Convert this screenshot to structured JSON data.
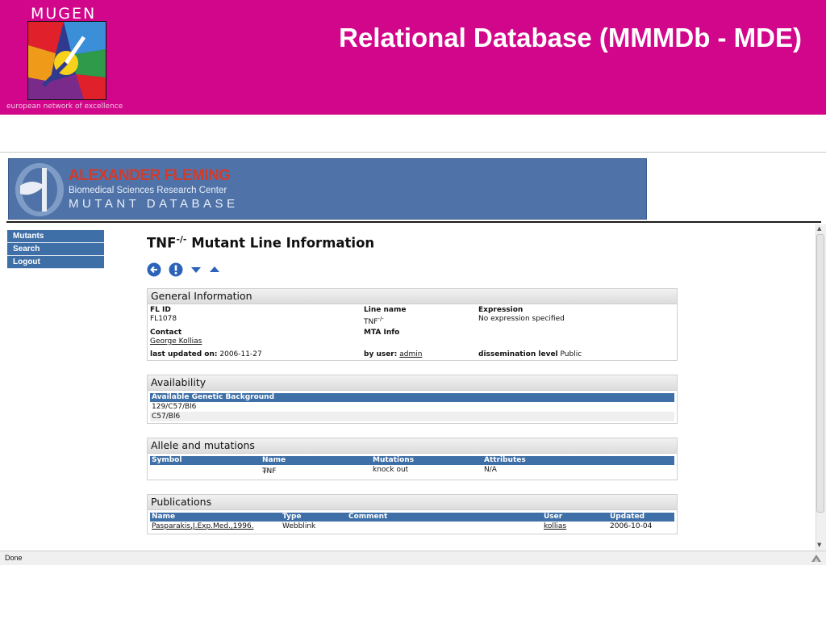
{
  "slide": {
    "logo_word": "MUGEN",
    "logo_tagline": "european network of excellence",
    "title": "Relational Database (MMMDb - MDE)"
  },
  "banner": {
    "name": "ALEXANDER FLEMING",
    "center": "Biomedical Sciences Research Center",
    "database": "MUTANT DATABASE"
  },
  "nav": {
    "items": [
      "Mutants",
      "Search",
      "Logout"
    ]
  },
  "page": {
    "heading_prefix": "TNF",
    "heading_sup": "-/-",
    "heading_suffix": " Mutant Line Information"
  },
  "toolbar": {
    "icons": [
      "back-icon",
      "info-icon",
      "expand-down-icon",
      "collapse-up-icon"
    ]
  },
  "general": {
    "title": "General Information",
    "fl_id_label": "FL ID",
    "fl_id": "FL1078",
    "line_name_label": "Line name",
    "line_name": "TNF",
    "line_name_sup": "-/-",
    "expression_label": "Expression",
    "expression": "No expression specified",
    "contact_label": "Contact",
    "contact": "George Kollias",
    "mta_label": "MTA Info",
    "updated_label": "last updated on:",
    "updated": "2006-11-27",
    "by_user_label": "by user:",
    "by_user": "admin",
    "dissemination_label": "dissemination level",
    "dissemination": "Public"
  },
  "availability": {
    "title": "Availability",
    "header": "Available Genetic Background",
    "rows": [
      "129/C57/Bl6",
      "C57/Bl6"
    ]
  },
  "allele": {
    "title": "Allele and mutations",
    "headers": [
      "Symbol",
      "Name",
      "Mutations",
      "Attributes"
    ],
    "row": {
      "symbol": "",
      "name": "TNF",
      "name_sup": "-/-",
      "mutations": "knock out",
      "attributes": "N/A"
    }
  },
  "publications": {
    "title": "Publications",
    "headers": [
      "Name",
      "Type",
      "Comment",
      "User",
      "Updated"
    ],
    "row": {
      "name": "Pasparakis,J.Exp.Med.,1996.",
      "type": "Webblink",
      "comment": "",
      "user": "kollias",
      "updated": "2006-10-04"
    }
  },
  "status": {
    "text": "Done"
  },
  "colors": {
    "band": "#d1068a",
    "banner": "#4f73a8",
    "table_header": "#3e6fa6",
    "nav": "#3e6fa6"
  }
}
